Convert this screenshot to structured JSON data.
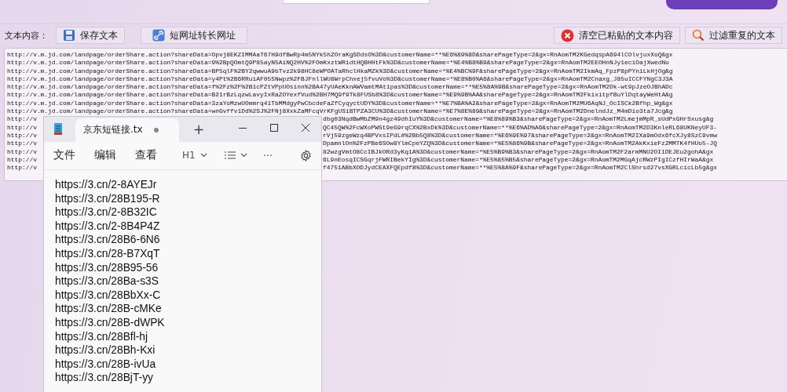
{
  "toolbar": {
    "label": "文本内容：",
    "left_buttons": [
      {
        "kind": "save",
        "label": "保存文本"
      },
      {
        "kind": "link",
        "label": "短网址转长网址"
      }
    ],
    "right_buttons": [
      {
        "kind": "clear",
        "label": "清空已粘贴的文本内容"
      },
      {
        "kind": "filter",
        "label": "过滤重复的文本"
      }
    ]
  },
  "text_area": {
    "lines": [
      "http://v.m.jd.com/landpage/orderShare.action?shareData=Opvj8EKZIMMAaT67H9dfBwRp4m5NYk5hZOraKgSDdsO%3D&customerName=**%E6%89%8D&sharePageType=2&gx=RnAomTM2KGedqspA694lCOlvjuxXoQ&gx",
      "http://v.m.jd.com/landpage/orderShare.action?shareData=9%2BpQOmtQ9P85ayN5AiNQ2HV%2FOmKxztWRidtHQBHHtFk%3D&customerName=*%E4%B8%B9&sharePageType=2&gx=RnAomTM2EEOHnNJy1eciOajXwedNu",
      "http://v.m.jd.com/landpage/orderShare.action?shareData=BP5qlF%2BY2qwwuA9bTvz2k98HC8eWPOATaRhclHkaMZk%3D&customerName=*%E4%BC%9F&sharePageType=2&gx=RnAomTM2IkmAq_FpzP8pPYniLkHjOg&g",
      "http://v.m.jd.com/landpage/orderShare.action?shareData=y4Pt%2B6RRuiAF055Nwpz%2FBJFnllWU8WrpChxej5fvuVo%3D&customerName=*%E8%B0%A6&sharePageType=2&gx=RnAomTM2Cnaxg_J85uICCFYNgC3J3A",
      "http://v.m.jd.com/landpage/orderShare.action?shareData=f%2Fz%2F%2B1cPZtVPpUOsinn%2BA47yUAeKknAWVamtMAt1pas%3D&customerName=**%E5%8A%9B&sharePageType=2&gx=RnAomTM2Dk-wt9pJzeOJBhADc",
      "http://v.m.jd.com/landpage/orderShare.action?shareData=B21rBzLqzwLavyIxRaZOYexfVud%2BH7MQ9f9Tk8FUSb8%3D&customerName=*%E9%9B%AA&sharePageType=2&gx=RnAomTM2FkixitpfBuYlDqtayWeHtA&g",
      "http://v.m.jd.com/landpage/orderShare.action?shareData=3zaYoMzwUOmmrq41TbMMdgyPwCbcdeFaZfCyqyctUDY%3D&customerName=**%E7%BA%A2&sharePageType=2&gx=RnAomTM2MU6AqNJ_OcISCk2Bfhp_Wg&gx",
      "http://v.m.jd.com/landpage/orderShare.action?shareData=wnGvffv1Dd%2SJ%2FNj8XxkZaMFcqVrKFgUSiBTPZA3CU%3D&customerName=*%E7%8E%89&sharePageType=2&gx=RnAomTM2DnelndJz_M4mDio3ta7Jcg&g"
    ],
    "covered_lines": [
      {
        "left": "http://v",
        "right": "dbg03NqdBwMbZM9n4gz49dhIuY%3D&customerName=*%E8%89%B3&sharePageType=2&gx=RnAomTM2LmejmMpR_sUdPxGHrSxusg&g"
      },
      {
        "left": "http://v",
        "right": "QC45QW%2FcWXoPWSt9eG9rqCX%2BxDk%3D&customerName=**%E6%AD%A6&sharePageType=2&gx=RnAomTM2D3KnleRL68UKNeyUF3-"
      },
      {
        "left": "http://v",
        "right": "rVj59zgeWzq4BPVxsIPdL#%2Bb5Q8%3D&customerName=*%E6%9E%97&sharePageType=2&gx=RnAomTM2IXa9mOdx6fcXJy8SzC9vmw"
      },
      {
        "left": "http://v",
        "right": "DpamnlOn%2FzPBe6SOw8YlmCpeYZQ%3D&customerName=*%E5%86%9B&sharePageType=2&gx=RnAomTM2AkKxieFz2MMTK4fHUo5-JQ"
      },
      {
        "left": "http://v",
        "right": "82wzgVmtO8CcIBJkORd3yKq1A%3D&customerName=*%E5%B9%B3&sharePageType=2&gx=RnAomTM2F2armMNU2OI1DEJEu2gohA&gx"
      },
      {
        "left": "http://v",
        "right": "6L9nEosqICSGqrjFWRIBekYIg%3D&customerName=*%E5%85%B5&sharePageType=2&gx=RnAomTM2MGqAjcRWzPIgICzfHIrWaA&gx"
      },
      {
        "left": "http://v",
        "right": "f4751ABbXODJydCEAXFQEpdf8%3D&customerName=**%E5%8A%9F&sharePageType=2&gx=RnAomTM2ClShrsd27vsXGRLcicLb5g&gx"
      }
    ]
  },
  "notepad": {
    "tab": {
      "title": "京东短链接.tx",
      "unsaved": true
    },
    "new_tab": "+",
    "menu": [
      "文件",
      "编辑",
      "查看"
    ],
    "heading_menu": "H1",
    "more": "···",
    "lines": [
      "https://3.cn/2-8AYEJr",
      "https://3.cn/28B195-R",
      "https://3.cn/2-8B32IC",
      "https://3.cn/2-8B4P4Z",
      "https://3.cn/28B6-6N6",
      "https://3.cn/28-B7XqT",
      "https://3.cn/28B95-56",
      "https://3.cn/28Ba-s3S",
      "https://3.cn/28BbXx-C",
      "https://3.cn/28B-cMKe",
      "https://3.cn/28B-dWPK",
      "https://3.cn/28Bfl-hj",
      "https://3.cn/28Bh-Kxi",
      "https://3.cn/28B-ivUa",
      "https://3.cn/28BjT-yy"
    ]
  }
}
